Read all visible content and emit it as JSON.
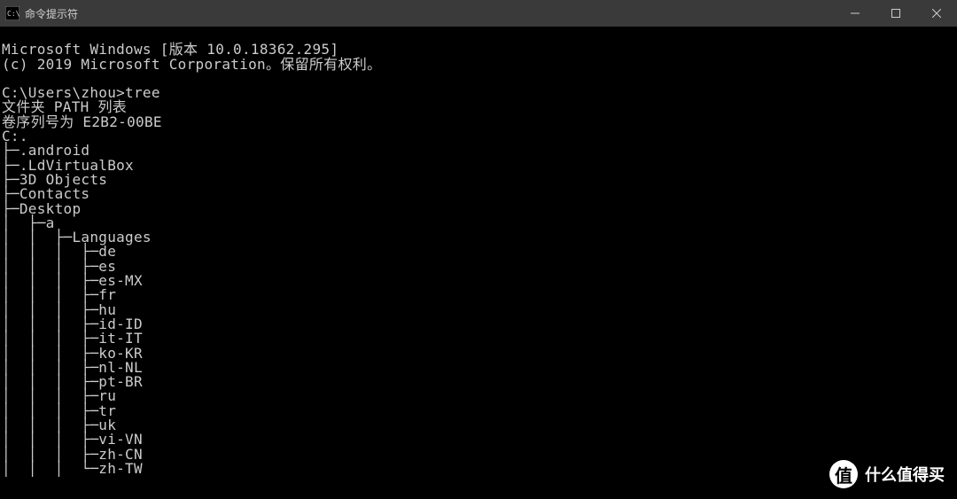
{
  "window": {
    "title": "命令提示符"
  },
  "terminal": {
    "header1": "Microsoft Windows [版本 10.0.18362.295]",
    "header2": "(c) 2019 Microsoft Corporation。保留所有权利。",
    "blank": "",
    "prompt": "C:\\Users\\zhou>tree",
    "line1": "文件夹 PATH 列表",
    "line2": "卷序列号为 E2B2-00BE",
    "line3": "C:.",
    "t01": "├─.android",
    "t02": "├─.LdVirtualBox",
    "t03": "├─3D Objects",
    "t04": "├─Contacts",
    "t05": "├─Desktop",
    "t06": "│  ├─a",
    "t07": "│  │  ├─Languages",
    "t08": "│  │  │  ├─de",
    "t09": "│  │  │  ├─es",
    "t10": "│  │  │  ├─es-MX",
    "t11": "│  │  │  ├─fr",
    "t12": "│  │  │  ├─hu",
    "t13": "│  │  │  ├─id-ID",
    "t14": "│  │  │  ├─it-IT",
    "t15": "│  │  │  ├─ko-KR",
    "t16": "│  │  │  ├─nl-NL",
    "t17": "│  │  │  ├─pt-BR",
    "t18": "│  │  │  ├─ru",
    "t19": "│  │  │  ├─tr",
    "t20": "│  │  │  ├─uk",
    "t21": "│  │  │  ├─vi-VN",
    "t22": "│  │  │  ├─zh-CN",
    "t23": "│  │  │  └─zh-TW"
  },
  "watermark": {
    "badge": "值",
    "text": "什么值得买"
  }
}
